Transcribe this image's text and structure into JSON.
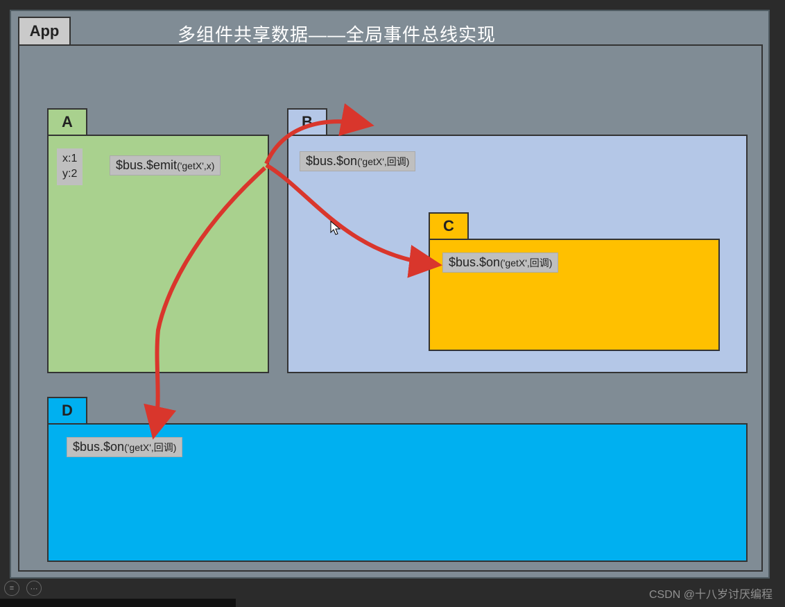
{
  "title": "多组件共享数据——全局事件总线实现",
  "app_label": "App",
  "components": {
    "A": {
      "label": "A",
      "vars": "x:1\ny:2",
      "code_method": "$bus.$emit",
      "code_args": "('getX',x)"
    },
    "B": {
      "label": "B",
      "code_method": "$bus.$on",
      "code_args": "('getX',回调)"
    },
    "C": {
      "label": "C",
      "code_method": "$bus.$on",
      "code_args": "('getX',回调)"
    },
    "D": {
      "label": "D",
      "code_method": "$bus.$on",
      "code_args": "('getX',回调)"
    }
  },
  "arrow_color": "#d9362c",
  "watermark": "CSDN @十八岁讨厌编程"
}
